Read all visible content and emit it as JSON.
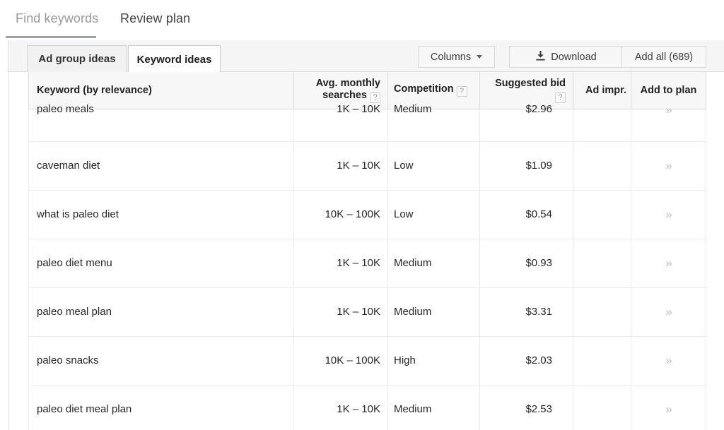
{
  "topnav": {
    "items": [
      {
        "label": "Find keywords",
        "active": true
      },
      {
        "label": "Review plan",
        "active": false
      }
    ]
  },
  "subtabs": [
    {
      "label": "Ad group ideas",
      "active": false
    },
    {
      "label": "Keyword ideas",
      "active": true
    }
  ],
  "toolbar": {
    "columns_label": "Columns",
    "download_label": "Download",
    "add_all_label": "Add all (689)",
    "download_icon": "download-icon",
    "caret_icon": "chevron-down-icon"
  },
  "table": {
    "columns": [
      {
        "label": "Keyword (by relevance)",
        "help": false
      },
      {
        "label_line1": "Avg. monthly",
        "label_line2": "searches",
        "help": true,
        "help_glyph": "?"
      },
      {
        "label": "Competition",
        "help": true,
        "help_glyph": "?"
      },
      {
        "label_line1": "Suggested bid",
        "label_line2": "",
        "help": true,
        "help_glyph": "?"
      },
      {
        "label": "Ad impr.",
        "help": false
      },
      {
        "label": "Add to plan",
        "help": false
      }
    ],
    "headers": {
      "keyword": "Keyword (by relevance)",
      "avg_line1": "Avg. monthly",
      "avg_line2": "searches",
      "competition": "Competition",
      "suggested_bid": "Suggested bid",
      "ad_impr": "Ad impr.",
      "add_to_plan": "Add to plan",
      "help_glyph": "?"
    },
    "add_glyph": "»",
    "rows": [
      {
        "keyword": "paleo meals",
        "avg_monthly_searches": "1K – 10K",
        "competition": "Medium",
        "suggested_bid": "$2.96",
        "ad_impr": "",
        "add": "»"
      },
      {
        "keyword": "caveman diet",
        "avg_monthly_searches": "1K – 10K",
        "competition": "Low",
        "suggested_bid": "$1.09",
        "ad_impr": "",
        "add": "»"
      },
      {
        "keyword": "what is paleo diet",
        "avg_monthly_searches": "10K – 100K",
        "competition": "Low",
        "suggested_bid": "$0.54",
        "ad_impr": "",
        "add": "»"
      },
      {
        "keyword": "paleo diet menu",
        "avg_monthly_searches": "1K – 10K",
        "competition": "Medium",
        "suggested_bid": "$0.93",
        "ad_impr": "",
        "add": "»"
      },
      {
        "keyword": "paleo meal plan",
        "avg_monthly_searches": "1K – 10K",
        "competition": "Medium",
        "suggested_bid": "$3.31",
        "ad_impr": "",
        "add": "»"
      },
      {
        "keyword": "paleo snacks",
        "avg_monthly_searches": "10K – 100K",
        "competition": "High",
        "suggested_bid": "$2.03",
        "ad_impr": "",
        "add": "»"
      },
      {
        "keyword": "paleo diet meal plan",
        "avg_monthly_searches": "1K – 10K",
        "competition": "Medium",
        "suggested_bid": "$2.53",
        "ad_impr": "",
        "add": "»"
      }
    ]
  },
  "colors": {
    "header_bg": "#f7f7f7",
    "active_tab_bg": "#ffffff",
    "inactive_tab_bg": "#f1f1f1",
    "border": "#dcdcdc",
    "text": "#262626",
    "muted_text": "#999999",
    "chevron": "#c0c0c0"
  }
}
